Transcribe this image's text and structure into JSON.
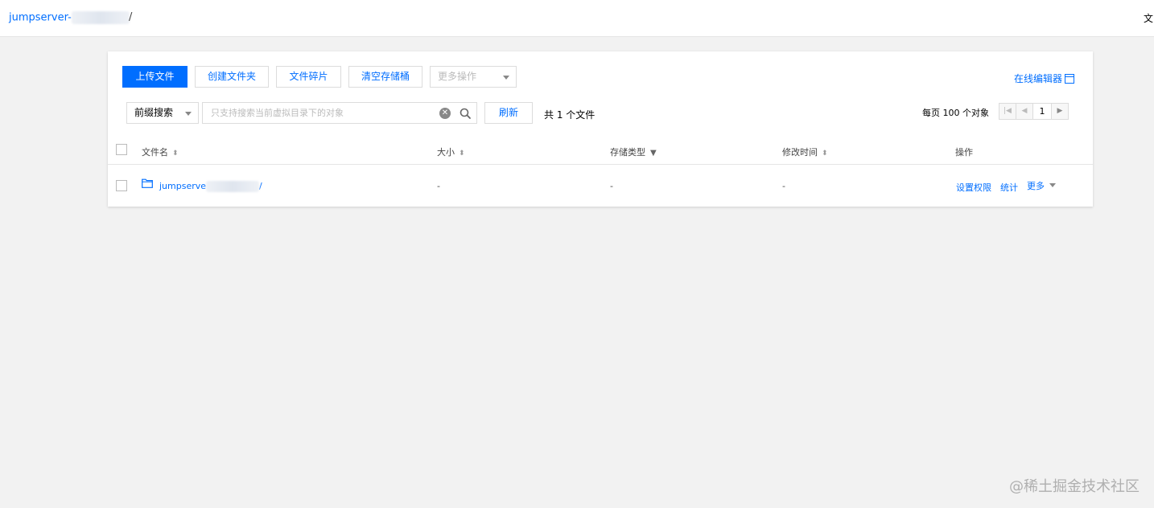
{
  "topbar": {
    "bucket_name": "jumpserver-",
    "breadcrumb_separator": "/",
    "right_text": "文"
  },
  "toolbar": {
    "upload_label": "上传文件",
    "create_folder_label": "创建文件夹",
    "fragments_label": "文件碎片",
    "clear_bucket_label": "清空存储桶",
    "more_actions_label": "更多操作",
    "online_editor_label": "在线编辑器"
  },
  "search": {
    "mode_label": "前缀搜索",
    "placeholder": "只支持搜索当前虚拟目录下的对象",
    "refresh_label": "刷新",
    "count_text": "共 1 个文件"
  },
  "pagination": {
    "per_page_text": "每页 100 个对象",
    "current_page": "1"
  },
  "table": {
    "columns": {
      "name": "文件名",
      "size": "大小",
      "storage_type": "存储类型",
      "modified": "修改时间",
      "actions": "操作"
    },
    "rows": [
      {
        "name_prefix": "jumpserve",
        "name_suffix": "/",
        "size": "-",
        "storage_type": "-",
        "modified": "-",
        "action_permissions": "设置权限",
        "action_stats": "统计",
        "action_more": "更多"
      }
    ]
  },
  "watermark": "@稀土掘金技术社区",
  "colors": {
    "accent": "#006eff",
    "background": "#f2f2f2"
  }
}
